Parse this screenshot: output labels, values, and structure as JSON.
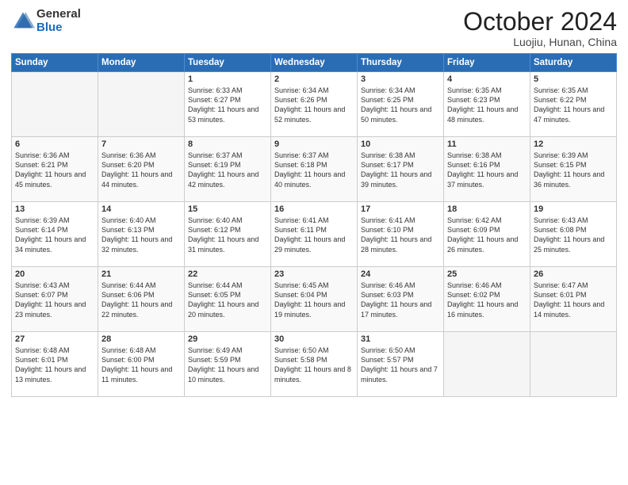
{
  "logo": {
    "general": "General",
    "blue": "Blue"
  },
  "title": "October 2024",
  "location": "Luojiu, Hunan, China",
  "days_of_week": [
    "Sunday",
    "Monday",
    "Tuesday",
    "Wednesday",
    "Thursday",
    "Friday",
    "Saturday"
  ],
  "weeks": [
    [
      {
        "day": "",
        "info": ""
      },
      {
        "day": "",
        "info": ""
      },
      {
        "day": "1",
        "info": "Sunrise: 6:33 AM\nSunset: 6:27 PM\nDaylight: 11 hours and 53 minutes."
      },
      {
        "day": "2",
        "info": "Sunrise: 6:34 AM\nSunset: 6:26 PM\nDaylight: 11 hours and 52 minutes."
      },
      {
        "day": "3",
        "info": "Sunrise: 6:34 AM\nSunset: 6:25 PM\nDaylight: 11 hours and 50 minutes."
      },
      {
        "day": "4",
        "info": "Sunrise: 6:35 AM\nSunset: 6:23 PM\nDaylight: 11 hours and 48 minutes."
      },
      {
        "day": "5",
        "info": "Sunrise: 6:35 AM\nSunset: 6:22 PM\nDaylight: 11 hours and 47 minutes."
      }
    ],
    [
      {
        "day": "6",
        "info": "Sunrise: 6:36 AM\nSunset: 6:21 PM\nDaylight: 11 hours and 45 minutes."
      },
      {
        "day": "7",
        "info": "Sunrise: 6:36 AM\nSunset: 6:20 PM\nDaylight: 11 hours and 44 minutes."
      },
      {
        "day": "8",
        "info": "Sunrise: 6:37 AM\nSunset: 6:19 PM\nDaylight: 11 hours and 42 minutes."
      },
      {
        "day": "9",
        "info": "Sunrise: 6:37 AM\nSunset: 6:18 PM\nDaylight: 11 hours and 40 minutes."
      },
      {
        "day": "10",
        "info": "Sunrise: 6:38 AM\nSunset: 6:17 PM\nDaylight: 11 hours and 39 minutes."
      },
      {
        "day": "11",
        "info": "Sunrise: 6:38 AM\nSunset: 6:16 PM\nDaylight: 11 hours and 37 minutes."
      },
      {
        "day": "12",
        "info": "Sunrise: 6:39 AM\nSunset: 6:15 PM\nDaylight: 11 hours and 36 minutes."
      }
    ],
    [
      {
        "day": "13",
        "info": "Sunrise: 6:39 AM\nSunset: 6:14 PM\nDaylight: 11 hours and 34 minutes."
      },
      {
        "day": "14",
        "info": "Sunrise: 6:40 AM\nSunset: 6:13 PM\nDaylight: 11 hours and 32 minutes."
      },
      {
        "day": "15",
        "info": "Sunrise: 6:40 AM\nSunset: 6:12 PM\nDaylight: 11 hours and 31 minutes."
      },
      {
        "day": "16",
        "info": "Sunrise: 6:41 AM\nSunset: 6:11 PM\nDaylight: 11 hours and 29 minutes."
      },
      {
        "day": "17",
        "info": "Sunrise: 6:41 AM\nSunset: 6:10 PM\nDaylight: 11 hours and 28 minutes."
      },
      {
        "day": "18",
        "info": "Sunrise: 6:42 AM\nSunset: 6:09 PM\nDaylight: 11 hours and 26 minutes."
      },
      {
        "day": "19",
        "info": "Sunrise: 6:43 AM\nSunset: 6:08 PM\nDaylight: 11 hours and 25 minutes."
      }
    ],
    [
      {
        "day": "20",
        "info": "Sunrise: 6:43 AM\nSunset: 6:07 PM\nDaylight: 11 hours and 23 minutes."
      },
      {
        "day": "21",
        "info": "Sunrise: 6:44 AM\nSunset: 6:06 PM\nDaylight: 11 hours and 22 minutes."
      },
      {
        "day": "22",
        "info": "Sunrise: 6:44 AM\nSunset: 6:05 PM\nDaylight: 11 hours and 20 minutes."
      },
      {
        "day": "23",
        "info": "Sunrise: 6:45 AM\nSunset: 6:04 PM\nDaylight: 11 hours and 19 minutes."
      },
      {
        "day": "24",
        "info": "Sunrise: 6:46 AM\nSunset: 6:03 PM\nDaylight: 11 hours and 17 minutes."
      },
      {
        "day": "25",
        "info": "Sunrise: 6:46 AM\nSunset: 6:02 PM\nDaylight: 11 hours and 16 minutes."
      },
      {
        "day": "26",
        "info": "Sunrise: 6:47 AM\nSunset: 6:01 PM\nDaylight: 11 hours and 14 minutes."
      }
    ],
    [
      {
        "day": "27",
        "info": "Sunrise: 6:48 AM\nSunset: 6:01 PM\nDaylight: 11 hours and 13 minutes."
      },
      {
        "day": "28",
        "info": "Sunrise: 6:48 AM\nSunset: 6:00 PM\nDaylight: 11 hours and 11 minutes."
      },
      {
        "day": "29",
        "info": "Sunrise: 6:49 AM\nSunset: 5:59 PM\nDaylight: 11 hours and 10 minutes."
      },
      {
        "day": "30",
        "info": "Sunrise: 6:50 AM\nSunset: 5:58 PM\nDaylight: 11 hours and 8 minutes."
      },
      {
        "day": "31",
        "info": "Sunrise: 6:50 AM\nSunset: 5:57 PM\nDaylight: 11 hours and 7 minutes."
      },
      {
        "day": "",
        "info": ""
      },
      {
        "day": "",
        "info": ""
      }
    ]
  ]
}
